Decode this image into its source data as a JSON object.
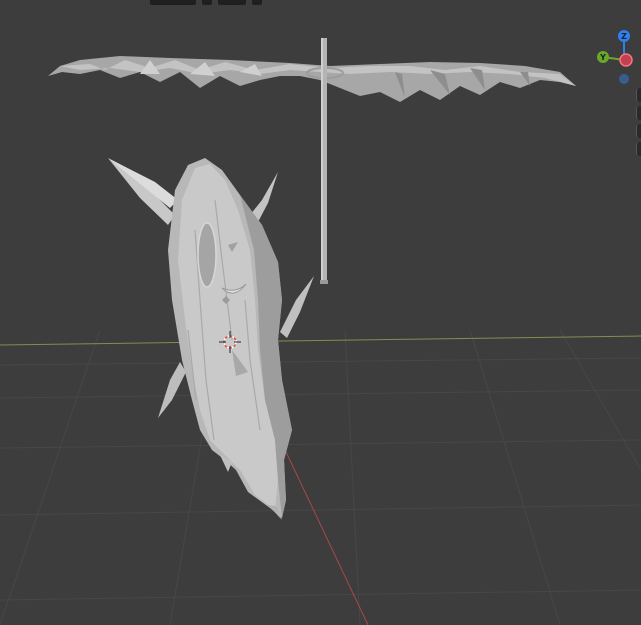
{
  "viewport": {
    "background": "#3d3d3d",
    "grid_color": "#484848",
    "x_axis_color": "#8a8a52",
    "y_axis_color": "#b05050",
    "mesh_color": "#b9b9b9"
  },
  "gizmo": {
    "z_label": "Z",
    "y_label": "Y",
    "z_color": "#2f7ff0",
    "y_color": "#6aa82a",
    "x_color": "#c0414f",
    "neg_z_color": "#3a5d90"
  },
  "icons": {
    "cursor": "3d-cursor-icon",
    "gizmo": "navigation-gizmo-icon"
  }
}
